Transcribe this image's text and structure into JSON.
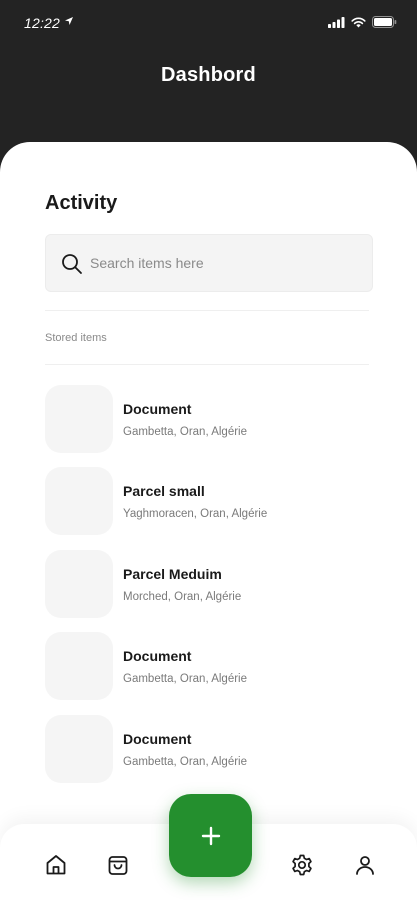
{
  "status_bar": {
    "time": "12:22"
  },
  "header": {
    "title": "Dashbord"
  },
  "activity": {
    "title": "Activity",
    "search": {
      "placeholder": "Search items here"
    },
    "section_label": "Stored items",
    "items": [
      {
        "title": "Document",
        "subtitle": "Gambetta, Oran, Algérie"
      },
      {
        "title": "Parcel small",
        "subtitle": "Yaghmoracen, Oran, Algérie"
      },
      {
        "title": "Parcel Meduim",
        "subtitle": "Morched, Oran, Algérie"
      },
      {
        "title": "Document",
        "subtitle": "Gambetta, Oran, Algérie"
      },
      {
        "title": "Document",
        "subtitle": "Gambetta, Oran, Algérie"
      }
    ]
  },
  "bottom_nav": {
    "items": [
      {
        "icon": "home-icon"
      },
      {
        "icon": "bag-icon"
      },
      {
        "icon": "gear-icon"
      },
      {
        "icon": "user-icon"
      }
    ]
  },
  "fab": {
    "icon": "plus-icon"
  },
  "colors": {
    "header_bg": "#232323",
    "accent": "#248f2e",
    "surface": "#ffffff",
    "placeholder_bg": "#f5f5f5"
  }
}
